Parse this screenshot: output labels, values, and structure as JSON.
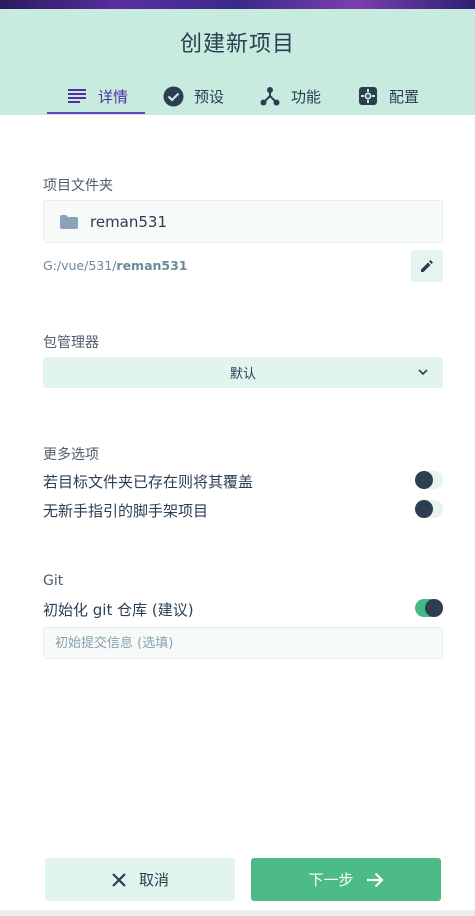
{
  "header": {
    "title": "创建新项目",
    "tabs": [
      {
        "label": "详情",
        "icon": "list-icon",
        "active": true
      },
      {
        "label": "预设",
        "icon": "check-circle-icon",
        "active": false
      },
      {
        "label": "功能",
        "icon": "branch-icon",
        "active": false
      },
      {
        "label": "配置",
        "icon": "gear-icon",
        "active": false
      }
    ]
  },
  "project_folder": {
    "label": "项目文件夹",
    "value": "reman531",
    "path_prefix": "G:/vue/531/",
    "path_name": "reman531"
  },
  "package_manager": {
    "label": "包管理器",
    "selected": "默认"
  },
  "more_options": {
    "label": "更多选项",
    "items": [
      {
        "label": "若目标文件夹已存在则将其覆盖",
        "enabled": false
      },
      {
        "label": "无新手指引的脚手架项目",
        "enabled": false
      }
    ]
  },
  "git": {
    "label": "Git",
    "init_label": "初始化 git 仓库 (建议)",
    "init_enabled": true,
    "commit_placeholder": "初始提交信息 (选填)",
    "commit_value": ""
  },
  "footer": {
    "cancel_label": "取消",
    "next_label": "下一步"
  },
  "colors": {
    "header_bg": "#c8ebe0",
    "accent_purple": "#4f2ea6",
    "primary_green": "#42b983",
    "text_dark": "#2c3e50"
  }
}
